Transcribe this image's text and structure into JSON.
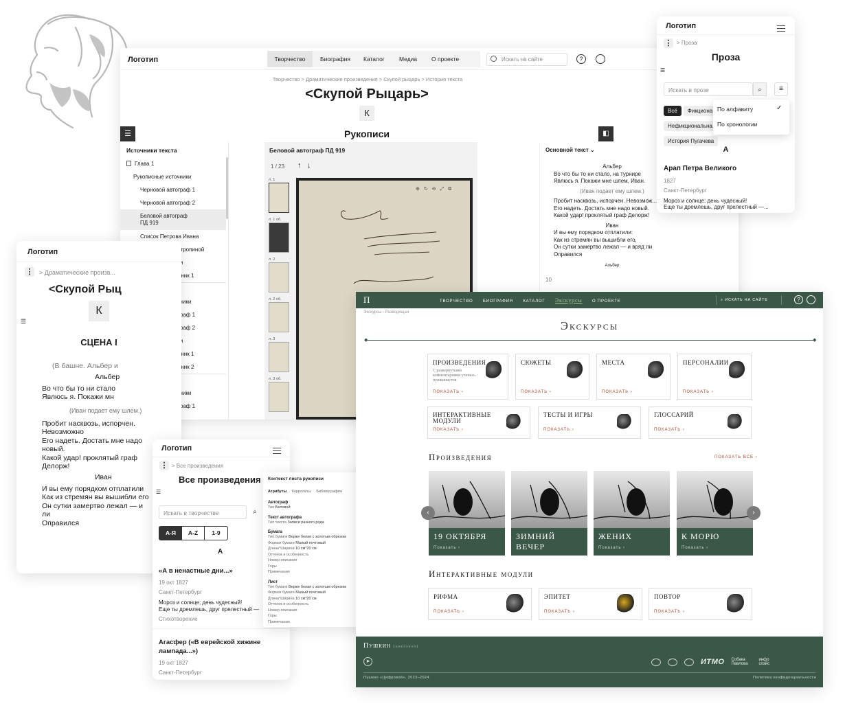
{
  "main_window": {
    "logo": "Логотип",
    "nav": [
      "Творчество",
      "Биография",
      "Каталог",
      "Медиа",
      "О проекте"
    ],
    "search_placeholder": "Искать на сайте",
    "breadcrumb": [
      "Творчество",
      "Драматические произведения",
      "Скупой рыцарь",
      "История текста"
    ],
    "title": "<Скупой Рыцарь>",
    "letter": "К",
    "section": "Рукописи",
    "sources_title": "Источники текста",
    "sources": [
      {
        "label": "Глава 1",
        "level": 0,
        "icon": "doc"
      },
      {
        "label": "Рукописные источники",
        "level": 1
      },
      {
        "label": "Черновой автограф 1",
        "level": 2
      },
      {
        "label": "Черновой автограф 2",
        "level": 2
      },
      {
        "label": "Беловой автограф",
        "label2": "ПД 919",
        "level": 2,
        "selected": true
      },
      {
        "label": "Список Петрова Ивана",
        "level": 2
      },
      {
        "label": "Копия Маши Антропиной",
        "level": 2
      },
      {
        "label": "Печатные иточники",
        "level": 1
      },
      {
        "label": "Печатный источник 1",
        "level": 2
      },
      {
        "label": "Глава 2",
        "level": 0,
        "icon": "doc"
      },
      {
        "label": "Рукописные источники",
        "level": 1
      },
      {
        "label": "Черновой автограф 1",
        "level": 2
      },
      {
        "label": "Черновой автограф 2",
        "level": 2
      },
      {
        "label": "Печатные иточники",
        "level": 1
      },
      {
        "label": "Печатный источник 1",
        "level": 2
      },
      {
        "label": "Печатный источник 2",
        "level": 2
      },
      {
        "label": "Глава 3",
        "level": 0,
        "icon": "doc"
      },
      {
        "label": "Рукописные источники",
        "level": 1
      },
      {
        "label": "Черновой автограф 1",
        "level": 2
      }
    ],
    "viewer_title": "Беловой автограф ПД 919",
    "pager": "1 / 23",
    "thumbs": [
      "л. 1",
      "л. 1 об.",
      "л. 2",
      "л. 2 об.",
      "л. 3",
      "л. 3 об."
    ],
    "text_select": "Основной текст",
    "text_lines": [
      {
        "t": "Альбер",
        "cls": "center"
      },
      {
        "t": "Во что бы то ни стало, на турнире"
      },
      {
        "t": "Явлюсь я. Покажи мне шлем, Иван."
      },
      {
        "t": "(Иван подает ему шлем.)",
        "cls": "stage"
      },
      {
        "t": "Пробит насквозь, испорчен. Невозмож..."
      },
      {
        "t": "Его надеть. Достать мне надо новый."
      },
      {
        "t": "Какой удар! проклятый граф Делорж!"
      },
      {
        "t": "Иван",
        "cls": "center"
      },
      {
        "t": "И вы ему порядком отплатили:"
      },
      {
        "t": "Как из стремян вы вышибли его,"
      },
      {
        "t": "Он сутки замертво лежал — и вряд ли"
      },
      {
        "t": "Оправился"
      },
      {
        "t": "Альбер",
        "cls": "center small"
      }
    ],
    "line_number": "10"
  },
  "prose_mobile": {
    "logo": "Логотип",
    "crumb": "Проза",
    "title": "Проза",
    "search_placeholder": "Искать в прозе",
    "filters": [
      "Всё",
      "Фикциона...",
      "Нефикциональна...",
      "История Пугачева"
    ],
    "sort_options": [
      "По алфавиту",
      "По хронологии"
    ],
    "letter": "А",
    "item_title": "Арап Петра Великого",
    "item_year": "1827",
    "item_place": "Санкт-Петербург",
    "item_excerpt": "Мороз и солнце; день чудесный!",
    "item_excerpt2": "Еще ты дремлешь, друг прелестный —..."
  },
  "play_mobile": {
    "logo": "Логотип",
    "crumb": "Драматические произв...",
    "title": "<Скупой Рыц",
    "letter": "К",
    "scene": "СЦЕНА I",
    "lines": [
      {
        "t": "(В башне. Альбер и",
        "cls": "stage"
      },
      {
        "t": "Альбер",
        "cls": "center"
      },
      {
        "t": "Во что бы то ни стало"
      },
      {
        "t": "Явлюсь я. Покажи мн"
      },
      {
        "t": "(Иван подает ему шлем.)",
        "cls": "stage small"
      },
      {
        "t": "Пробит насквозь, испорчен."
      },
      {
        "t": "Невозможно"
      },
      {
        "t": "Его надеть. Достать мне надо"
      },
      {
        "t": "новый."
      },
      {
        "t": "Какой удар! проклятый граф"
      },
      {
        "t": "Делорж!"
      },
      {
        "t": "Иван",
        "cls": "center"
      },
      {
        "t": "И вы ему порядком отплатили"
      },
      {
        "t": "Как из стремян вы вышибли его"
      },
      {
        "t": "Он сутки замертво лежал — и"
      },
      {
        "t": "ли"
      },
      {
        "t": "Оправился"
      }
    ]
  },
  "works_mobile": {
    "logo": "Логотип",
    "crumb": "Все произведения",
    "title": "Все произведения",
    "search_placeholder": "Искать в творчестве",
    "sort": [
      "А-Я",
      "А-Z",
      "1-9"
    ],
    "letter": "А",
    "items": [
      {
        "title": "«А в ненастные дни...»",
        "date": "19 окт 1827",
        "place": "Санкт-Петербург",
        "excerpt": "Мороз и солнце; день чудесный!",
        "excerpt2": "Еще ты дремлешь, друг прелестный —",
        "tag": "Стихотворение"
      },
      {
        "title": "Агасфер («В еврейской хижине лампада...»)",
        "date": "19 окт 1827",
        "place": "Санкт-Петербург"
      }
    ]
  },
  "context_panel": {
    "title": "Контекст листа рукописи",
    "tabs": [
      "Атрибуты",
      "Корролиты",
      "Библиография"
    ],
    "groups": [
      {
        "label": "Автограф",
        "rows": [
          [
            "Тип",
            "Беловой"
          ]
        ]
      },
      {
        "label": "Текст автографа",
        "rows": [
          [
            "Тип текста",
            "Записи разного рода"
          ]
        ]
      },
      {
        "label": "Бумага",
        "rows": [
          [
            "Тип бумаги",
            "Верже белая с золотым обрезом"
          ],
          [
            "Формат бумаги",
            "Малый почтовый"
          ],
          [
            "Длина*Ширина",
            "10 см*20 см"
          ],
          [
            "Оттенок и особенность",
            ""
          ],
          [
            "Номер описания",
            ""
          ],
          [
            "Горы",
            ""
          ],
          [
            "Примечания",
            ""
          ]
        ]
      },
      {
        "label": "Лист",
        "rows": [
          [
            "Тип бумаги",
            "Верже белая с золотым обрезом"
          ],
          [
            "Формат бумаги",
            "Малый почтовый"
          ],
          [
            "Длина*Ширина",
            "10 см*20 см"
          ],
          [
            "Оттенок и особенность",
            ""
          ],
          [
            "Номер описания",
            ""
          ],
          [
            "Горы",
            ""
          ],
          [
            "Примечания",
            ""
          ]
        ]
      }
    ]
  },
  "excursus": {
    "logo": "П",
    "nav": [
      "Творчество",
      "Биография",
      "Каталог",
      "Экскурсы",
      "О проекте"
    ],
    "search": "Искать на сайте",
    "breadcrumb": [
      "Экскурсы",
      "Разводящая"
    ],
    "title": "Экскурсы",
    "tiles_row1": [
      {
        "t": "Произведения",
        "d": "С развернутыми комментариями ученых-пушкинистов",
        "more": "Показать"
      },
      {
        "t": "Сюжеты",
        "more": "Показать"
      },
      {
        "t": "Места",
        "more": "Показать"
      },
      {
        "t": "Персоналии",
        "more": "Показать"
      }
    ],
    "tiles_row2": [
      {
        "t": "Интерактивные модули",
        "more": "Показать"
      },
      {
        "t": "Тесты и игры",
        "more": "Показать"
      },
      {
        "t": "Глоссарий",
        "more": "Показать"
      }
    ],
    "works_heading": "Произведения",
    "show_all": "Показать все",
    "works": [
      {
        "t": "19 октября",
        "more": "Показать"
      },
      {
        "t": "Зимний вечер",
        "more": "Показать"
      },
      {
        "t": "Жених",
        "more": "Показать"
      },
      {
        "t": "К морю",
        "more": "Показать"
      }
    ],
    "modules_heading": "Интерактивные модули",
    "modules": [
      {
        "t": "Рифма",
        "more": "Показать"
      },
      {
        "t": "Эпитет",
        "more": "Показать"
      },
      {
        "t": "Повтор",
        "more": "Показать"
      }
    ],
    "footer_brand": "Пушкин",
    "footer_brand_sub": "(цифровой)",
    "footer_copy": "Пушкин «Цифровой», 2023–2024",
    "footer_policy": "Политика конфиденциальности",
    "partners": [
      "ИТМО",
      "Собака Павлова",
      "инфо спэйс"
    ],
    "colors": {
      "green": "#3b5747",
      "accent": "#b0472b"
    }
  }
}
